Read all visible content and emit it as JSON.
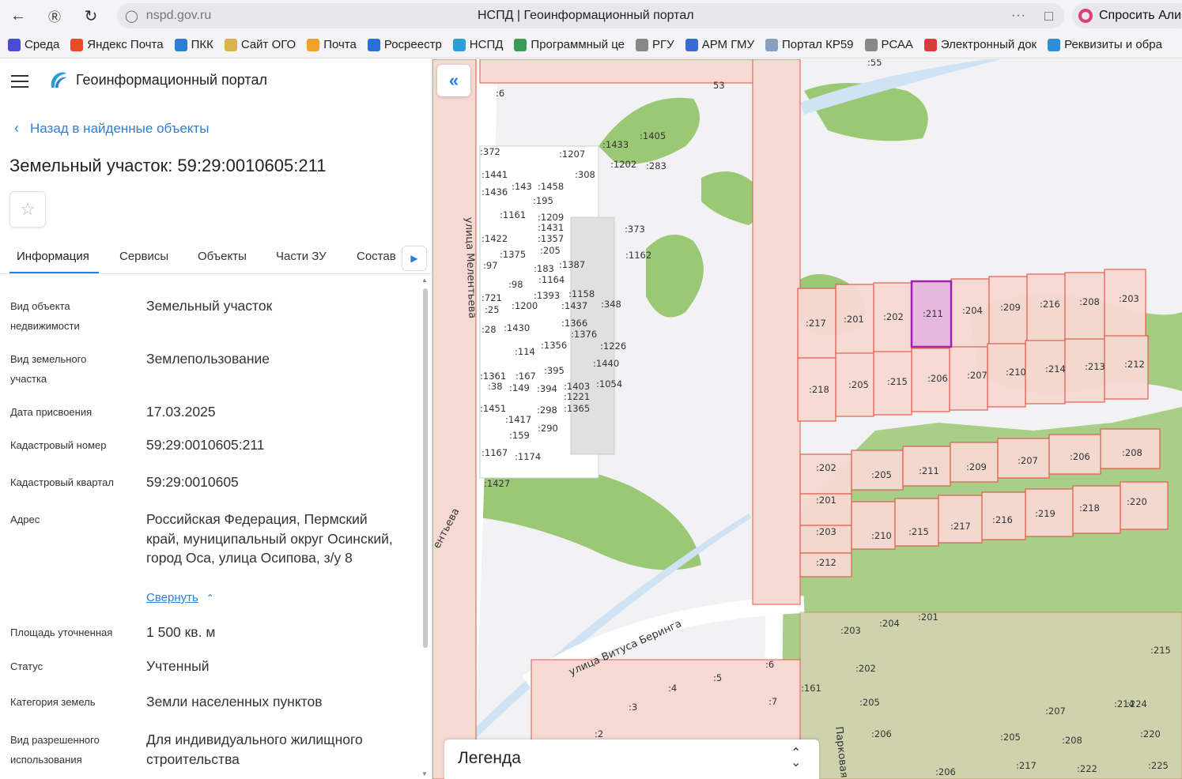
{
  "browser": {
    "url": "nspd.gov.ru",
    "tab_title": "НСПД | Геоинформационный портал",
    "more": "···",
    "ask_label": "Спросить Али"
  },
  "bookmarks": [
    {
      "label": "Среда",
      "color": "#4a4ad6"
    },
    {
      "label": "Яндекс Почта",
      "color": "#e84a2a"
    },
    {
      "label": "ПКК",
      "color": "#2b7fd9"
    },
    {
      "label": "Сайт ОГО",
      "color": "#d9b44a"
    },
    {
      "label": "Почта",
      "color": "#f2a12b"
    },
    {
      "label": "Росреестр",
      "color": "#2b6fd9"
    },
    {
      "label": "НСПД",
      "color": "#2b9fd9"
    },
    {
      "label": "Программный це",
      "color": "#3a9a5a"
    },
    {
      "label": "РГУ",
      "color": "#888888"
    },
    {
      "label": "АРМ ГМУ",
      "color": "#3a6ad9"
    },
    {
      "label": "Портал КР59",
      "color": "#8aa0c0"
    },
    {
      "label": "РСАА",
      "color": "#888888"
    },
    {
      "label": "Электронный док",
      "color": "#d93a3a"
    },
    {
      "label": "Реквизиты и обра",
      "color": "#2b8fd9"
    }
  ],
  "panel": {
    "portal_title": "Геоинформационный портал",
    "back_label": "Назад в найденные объекты",
    "object_title": "Земельный участок: 59:29:0010605:211",
    "tabs": [
      "Информация",
      "Сервисы",
      "Объекты",
      "Части ЗУ",
      "Состав"
    ],
    "fields": [
      {
        "label": "Вид объекта недвижимости",
        "value": "Земельный участок"
      },
      {
        "label": "Вид земельного участка",
        "value": "Землепользование"
      },
      {
        "label": "Дата присвоения",
        "value": "17.03.2025"
      },
      {
        "label": "Кадастровый номер",
        "value": "59:29:0010605:211"
      },
      {
        "label": "Кадастровый квартал",
        "value": "59:29:0010605"
      },
      {
        "label": "Адрес",
        "value": "Российская Федерация, Пермский край, муниципальный округ Осинский, город Оса, улица Осипова, з/у 8"
      },
      {
        "label": "Площадь уточненная",
        "value": "1 500 кв. м"
      },
      {
        "label": "Статус",
        "value": "Учтенный"
      },
      {
        "label": "Категория земель",
        "value": "Земли населенных пунктов"
      },
      {
        "label": "Вид разрешенного использования",
        "value": "Для индивидуального жилищного строительства"
      }
    ],
    "collapse_label": "Свернуть"
  },
  "map": {
    "legend_label": "Легенда",
    "streets": [
      "улица Мелентьева",
      "улица Витуса Беринга",
      "Парковая",
      "ентьева"
    ],
    "selected_parcel": ":211",
    "colors": {
      "parcel_fill": "#f7d9d3",
      "parcel_stroke": "#e2584a",
      "green": "#9bc874",
      "selected": "#a020b0",
      "water": "#cfe3f5"
    }
  }
}
